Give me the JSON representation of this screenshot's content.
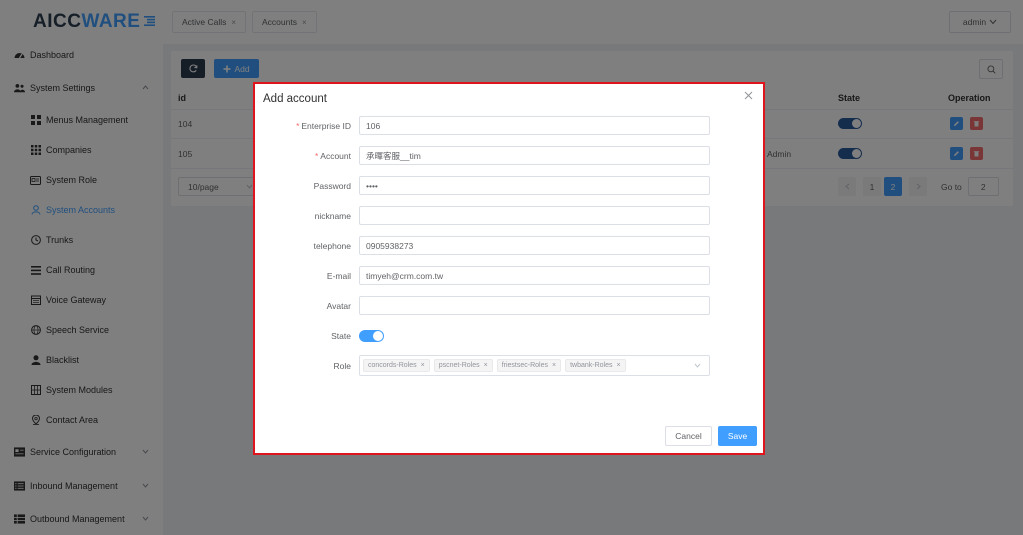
{
  "app": {
    "logo_text": "AICCWARE",
    "logo_part1": "AICC",
    "logo_part2": "WARE"
  },
  "colors": {
    "primary": "#409eff",
    "danger": "#f56c6c",
    "dark": "#2b3a4f",
    "highlight_border": "#e0141d"
  },
  "sidebar": {
    "items": [
      {
        "label": "Dashboard",
        "icon": "dashboard-icon",
        "level": "top"
      },
      {
        "label": "System Settings",
        "icon": "users-icon",
        "level": "top",
        "expanded": true
      },
      {
        "label": "Menus Management",
        "icon": "grid-icon",
        "level": "sub"
      },
      {
        "label": "Companies",
        "icon": "building-grid-icon",
        "level": "sub"
      },
      {
        "label": "System Role",
        "icon": "id-card-icon",
        "level": "sub"
      },
      {
        "label": "System Accounts",
        "icon": "user-icon",
        "level": "sub",
        "active": true
      },
      {
        "label": "Trunks",
        "icon": "clock-icon",
        "level": "sub"
      },
      {
        "label": "Call Routing",
        "icon": "list-icon",
        "level": "sub"
      },
      {
        "label": "Voice Gateway",
        "icon": "calendar-icon",
        "level": "sub"
      },
      {
        "label": "Speech Service",
        "icon": "globe-icon",
        "level": "sub"
      },
      {
        "label": "Blacklist",
        "icon": "person-icon",
        "level": "sub"
      },
      {
        "label": "System Modules",
        "icon": "table-icon",
        "level": "sub"
      },
      {
        "label": "Contact Area",
        "icon": "location-icon",
        "level": "sub"
      },
      {
        "label": "Service Configuration",
        "icon": "config-icon",
        "level": "top"
      },
      {
        "label": "Inbound Management",
        "icon": "inbound-icon",
        "level": "top"
      },
      {
        "label": "Outbound Management",
        "icon": "outbound-icon",
        "level": "top"
      }
    ]
  },
  "header": {
    "tabs": [
      {
        "label": "Active Calls",
        "close": "×"
      },
      {
        "label": "Accounts",
        "close": "×"
      }
    ],
    "user": "admin"
  },
  "toolbar": {
    "add_label": "Add"
  },
  "table": {
    "columns": {
      "id": "id",
      "state": "State",
      "operation": "Operation"
    },
    "rows": [
      {
        "id": "104",
        "role": "",
        "state": true
      },
      {
        "id": "105",
        "role": "Admin",
        "state": true
      }
    ]
  },
  "pagination": {
    "page_size": "10/page",
    "pages": [
      "1",
      "2"
    ],
    "current_page": 2,
    "goto_label": "Go to",
    "goto_value": "2"
  },
  "dialog": {
    "title": "Add account",
    "fields": {
      "enterprise_id": {
        "label": "Enterprise ID",
        "required": "*",
        "value": "106"
      },
      "account": {
        "label": "Account",
        "required": "*",
        "value": "承暉客服__tim"
      },
      "password": {
        "label": "Password",
        "value": "••••"
      },
      "nickname": {
        "label": "nickname",
        "value": ""
      },
      "telephone": {
        "label": "telephone",
        "value": "0905938273"
      },
      "email": {
        "label": "E-mail",
        "value": "timyeh@crm.com.tw"
      },
      "avatar": {
        "label": "Avatar",
        "value": ""
      },
      "state": {
        "label": "State",
        "on": true
      },
      "role": {
        "label": "Role",
        "tags": [
          "concords-Roles",
          "pscnet-Roles",
          "friestsec-Roles",
          "twbank-Roles"
        ]
      }
    },
    "cancel_label": "Cancel",
    "save_label": "Save"
  }
}
